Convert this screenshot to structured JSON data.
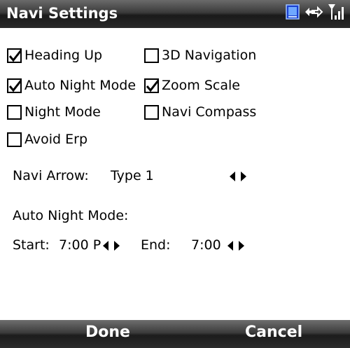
{
  "title_bar": {
    "title": "Navi Settings",
    "icons": [
      "device-icon",
      "connectivity-icon",
      "signal-strength-icon"
    ]
  },
  "options": [
    {
      "label": "Heading Up",
      "checked": true
    },
    {
      "label": "3D Navigation",
      "checked": false
    },
    {
      "label": "Auto Night Mode",
      "checked": true
    },
    {
      "label": "Zoom Scale",
      "checked": true
    },
    {
      "label": "Night Mode",
      "checked": false
    },
    {
      "label": "Navi Compass",
      "checked": false
    },
    {
      "label": "Avoid Erp",
      "checked": false
    }
  ],
  "navi_arrow": {
    "label": "Navi Arrow:",
    "value": "Type 1"
  },
  "auto_night_mode": {
    "heading": "Auto Night Mode:",
    "start_label": "Start:",
    "start_value": "7:00 P",
    "end_label": "End:",
    "end_value": "7:00"
  },
  "softkeys": {
    "left": "Done",
    "right": "Cancel"
  }
}
